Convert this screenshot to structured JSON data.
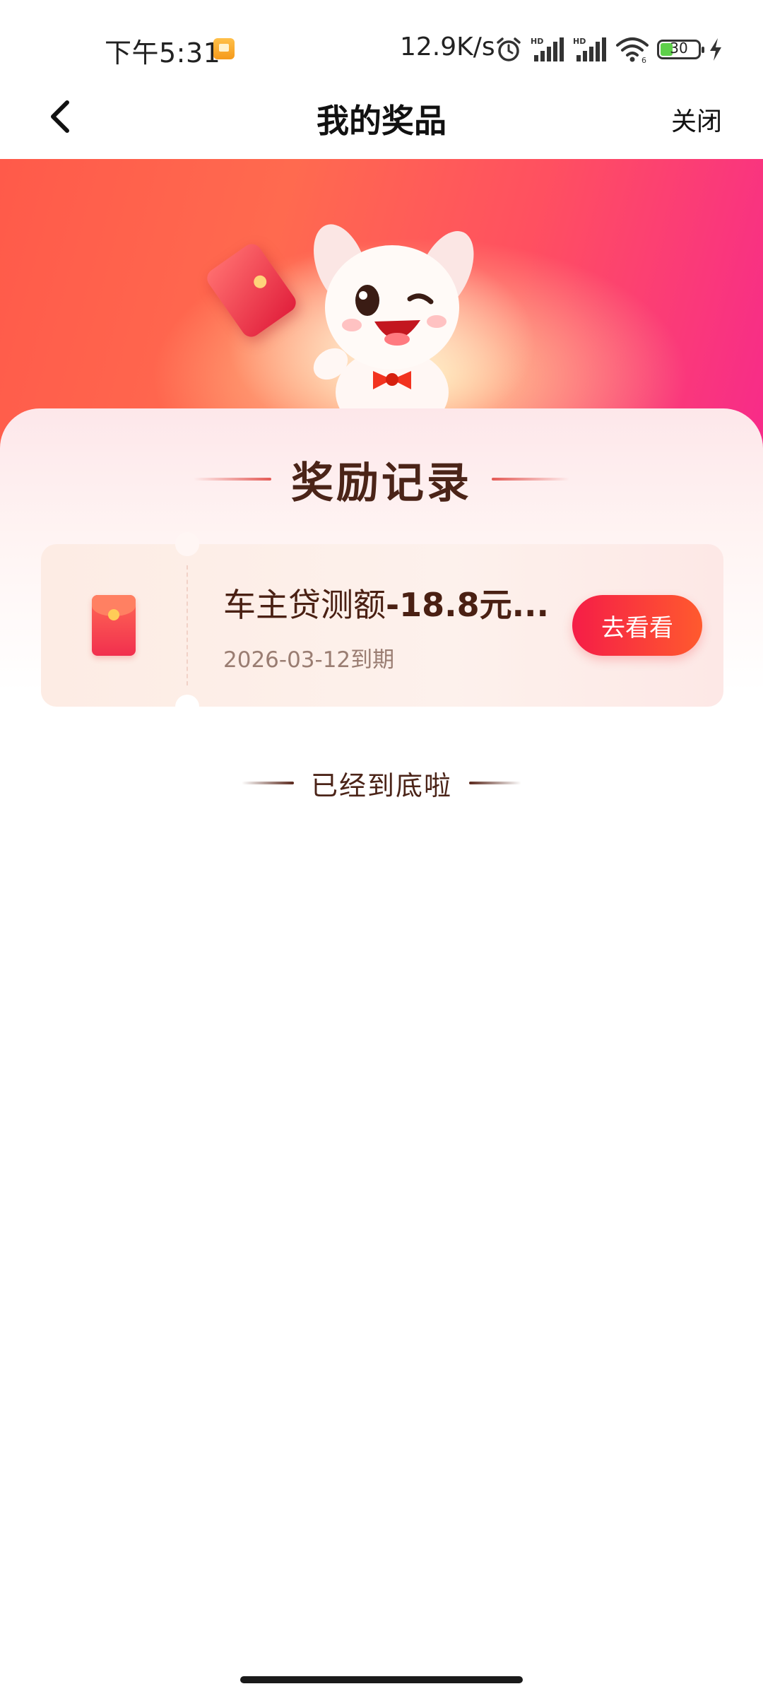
{
  "status_bar": {
    "time": "下午5:31",
    "network_speed": "12.9K/s",
    "battery_level": "30",
    "battery_fraction": 0.3,
    "icons": [
      "notification-icon",
      "alarm-icon",
      "signal-hd-icon",
      "signal-hd-icon",
      "wifi-icon",
      "battery-icon",
      "charging-icon"
    ]
  },
  "nav": {
    "title": "我的奖品",
    "close_label": "关闭",
    "back_icon": "chevron-left-icon"
  },
  "section": {
    "heading": "奖励记录"
  },
  "rewards": [
    {
      "title_prefix": "车主贷测额",
      "title_amount": "-18.8元...",
      "expiry": "2026-03-12到期",
      "action_label": "去看看",
      "icon": "red-envelope-icon"
    }
  ],
  "footer": {
    "end_text": "已经到底啦"
  },
  "colors": {
    "accent": "#f51d47",
    "accent_end": "#ff5a2e",
    "heading_text": "#4b2418",
    "banner_start": "#ff5a4a",
    "banner_end": "#f72a8a"
  }
}
